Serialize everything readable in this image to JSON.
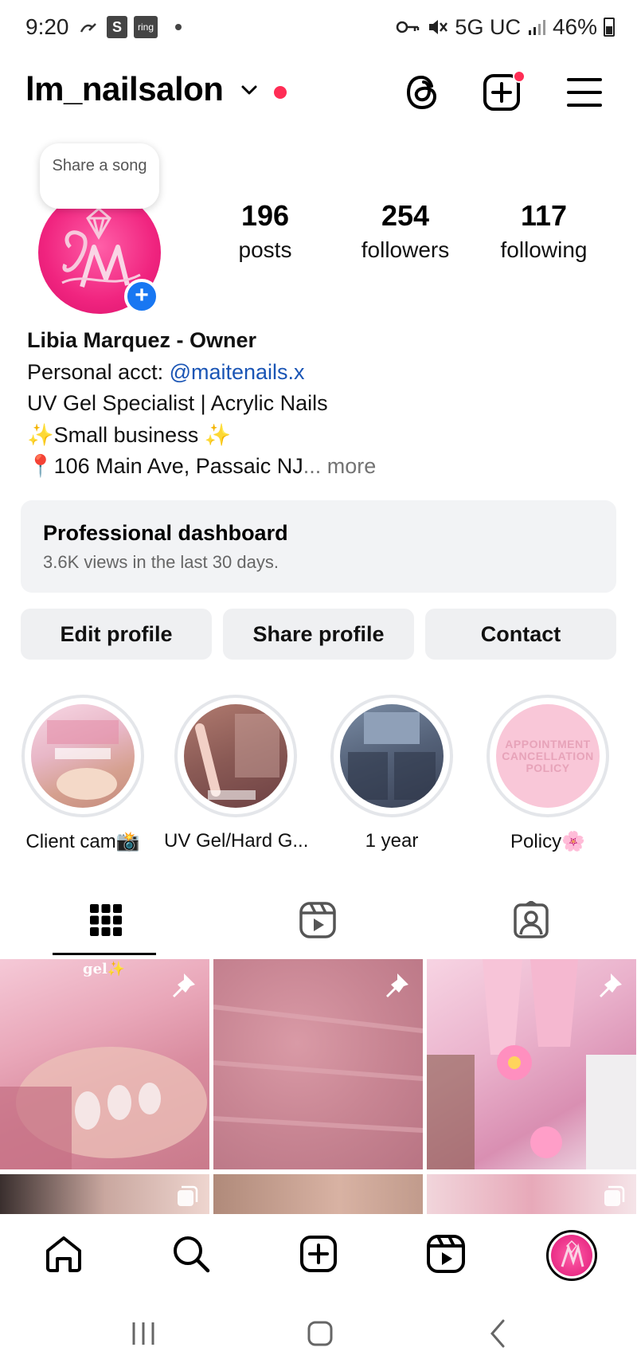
{
  "status_bar": {
    "time": "9:20",
    "box1": "S",
    "box2": "ring",
    "network": "5G UC",
    "battery": "46%"
  },
  "header": {
    "username": "lm_nailsalon"
  },
  "profile": {
    "song_bubble": "Share a song",
    "stats": [
      {
        "value": "196",
        "label": "posts"
      },
      {
        "value": "254",
        "label": "followers"
      },
      {
        "value": "117",
        "label": "following"
      }
    ],
    "bio": {
      "name": "Libia Marquez - Owner",
      "line1_prefix": "Personal acct: ",
      "line1_link": "@maitenails.x",
      "line2": "UV Gel Specialist | Acrylic Nails",
      "line3": "✨Small business ✨",
      "line4": "📍106 Main Ave, Passaic NJ",
      "more": "... more"
    }
  },
  "dashboard": {
    "title": "Professional dashboard",
    "subtitle": "3.6K views in the last 30 days."
  },
  "actions": {
    "edit": "Edit profile",
    "share": "Share profile",
    "contact": "Contact"
  },
  "highlights": [
    {
      "label": "Client cam📸"
    },
    {
      "label": "UV Gel/Hard G..."
    },
    {
      "label": "1 year"
    },
    {
      "label": "Policy🌸",
      "image_text": "APPOINTMENT CANCELLATION POLICY"
    }
  ],
  "posts": {
    "first_caption": "gel✨"
  },
  "colors": {
    "accent_blue": "#1877f2",
    "notification_red": "#ff2d55",
    "link": "#1a55b5",
    "brand_pink": "#f0247f"
  }
}
